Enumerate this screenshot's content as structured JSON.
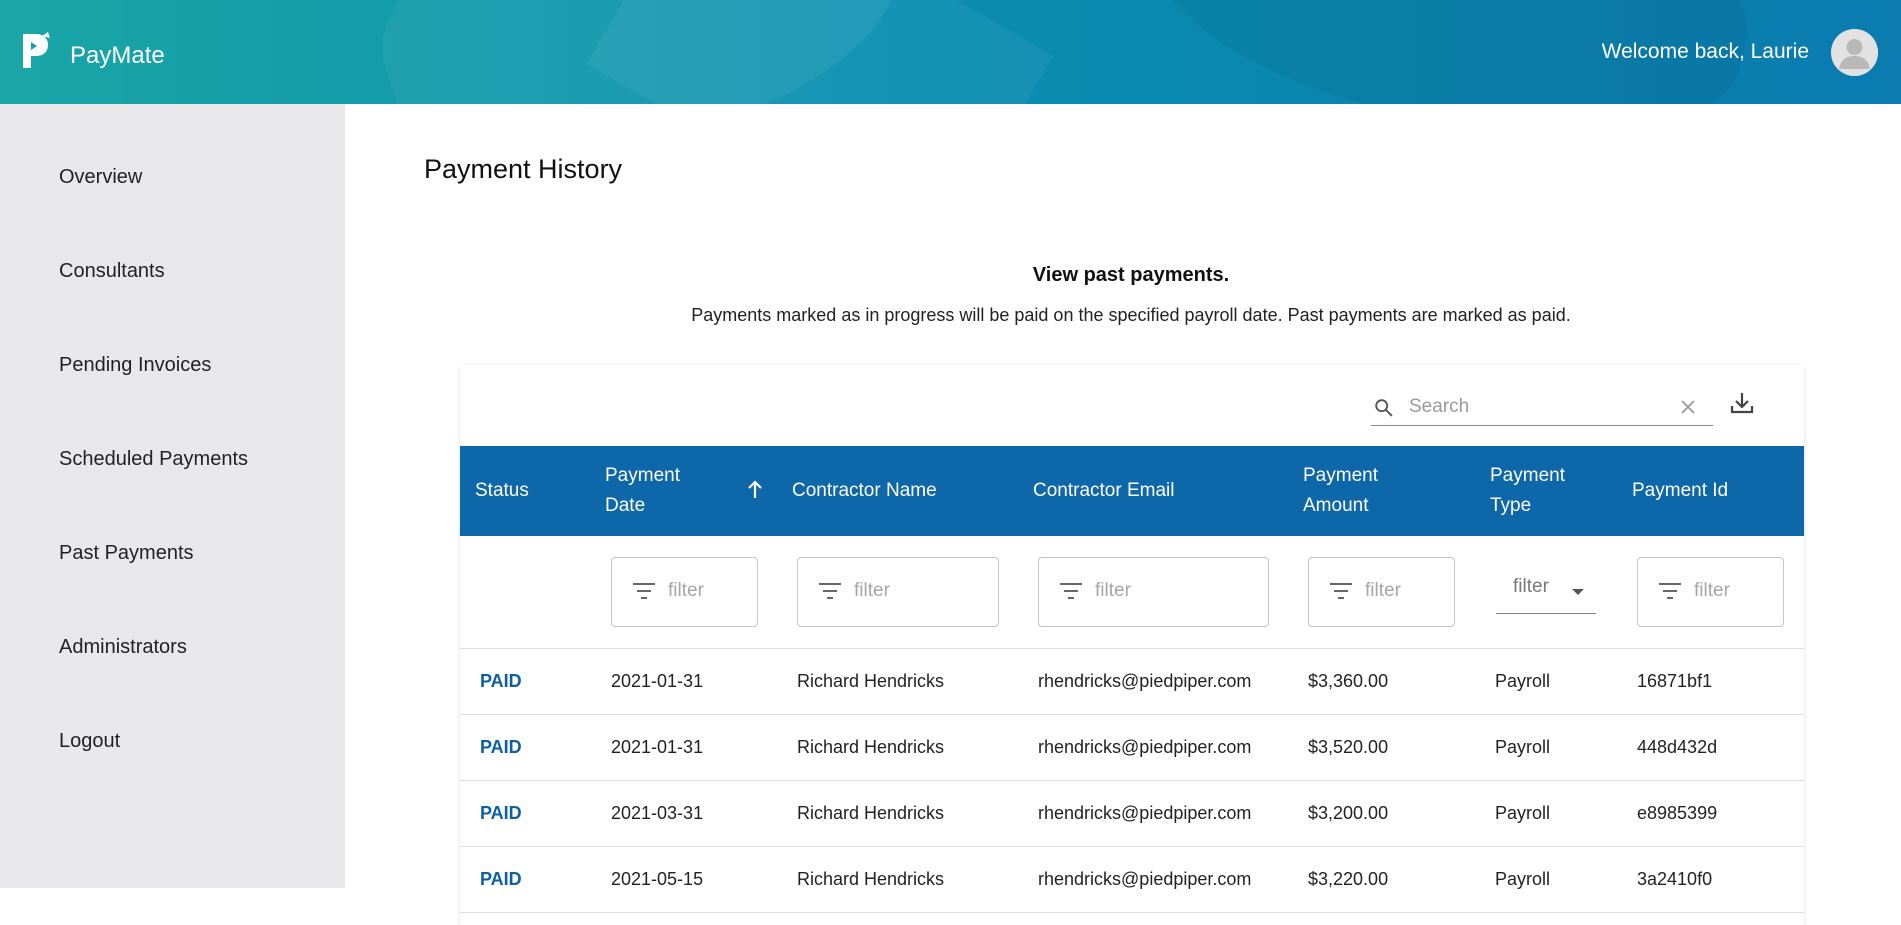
{
  "app": {
    "name": "PayMate",
    "welcome": "Welcome back, Laurie"
  },
  "sidebar": {
    "items": [
      {
        "label": "Overview"
      },
      {
        "label": "Consultants"
      },
      {
        "label": "Pending Invoices"
      },
      {
        "label": "Scheduled Payments"
      },
      {
        "label": "Past Payments"
      },
      {
        "label": "Administrators"
      },
      {
        "label": "Logout"
      }
    ]
  },
  "page": {
    "title": "Payment History",
    "heading": "View past payments.",
    "description": "Payments marked as in progress will be paid on the specified payroll date. Past payments are marked as paid."
  },
  "search": {
    "placeholder": "Search",
    "value": ""
  },
  "table": {
    "columns": [
      {
        "line1": "Status",
        "line2": ""
      },
      {
        "line1": "Payment",
        "line2": "Date"
      },
      {
        "line1": "Contractor Name",
        "line2": ""
      },
      {
        "line1": "Contractor Email",
        "line2": ""
      },
      {
        "line1": "Payment",
        "line2": "Amount"
      },
      {
        "line1": "Payment",
        "line2": "Type"
      },
      {
        "line1": "Payment Id",
        "line2": ""
      }
    ],
    "filter_placeholder": "filter",
    "rows": [
      {
        "status": "PAID",
        "date": "2021-01-31",
        "name": "Richard Hendricks",
        "email": "rhendricks@piedpiper.com",
        "amount": "$3,360.00",
        "type": "Payroll",
        "id": "16871bf1"
      },
      {
        "status": "PAID",
        "date": "2021-01-31",
        "name": "Richard Hendricks",
        "email": "rhendricks@piedpiper.com",
        "amount": "$3,520.00",
        "type": "Payroll",
        "id": "448d432d"
      },
      {
        "status": "PAID",
        "date": "2021-03-31",
        "name": "Richard Hendricks",
        "email": "rhendricks@piedpiper.com",
        "amount": "$3,200.00",
        "type": "Payroll",
        "id": "e8985399"
      },
      {
        "status": "PAID",
        "date": "2021-05-15",
        "name": "Richard Hendricks",
        "email": "rhendricks@piedpiper.com",
        "amount": "$3,220.00",
        "type": "Payroll",
        "id": "3a2410f0"
      }
    ]
  },
  "colors": {
    "header_bg": "#0d67a8",
    "status_paid": "#0d5fa1",
    "sidebar_bg": "#e8e8ea",
    "topbar_start": "#1aa6a6",
    "topbar_end": "#0b7bb0"
  },
  "icons": {
    "logo": "paymate-logo-icon",
    "avatar": "user-avatar-icon",
    "search": "search-icon",
    "clear": "close-icon",
    "download": "download-icon",
    "sort": "arrow-up-icon",
    "filter": "filter-list-icon",
    "dropdown": "chevron-down-icon"
  }
}
